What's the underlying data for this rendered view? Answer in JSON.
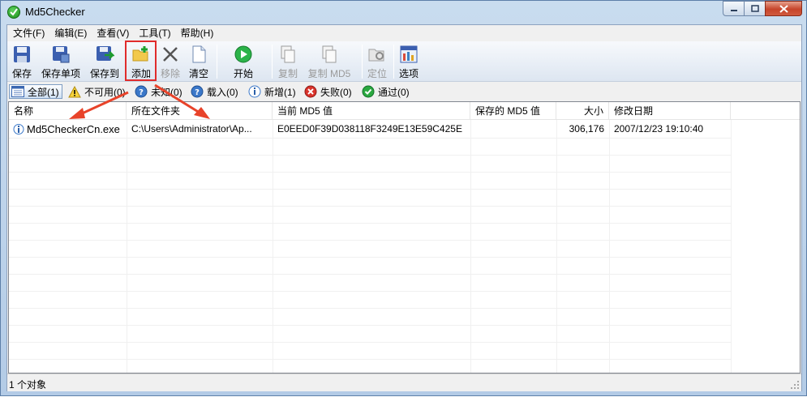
{
  "window": {
    "title": "Md5Checker"
  },
  "menu": [
    "文件(F)",
    "编辑(E)",
    "查看(V)",
    "工具(T)",
    "帮助(H)"
  ],
  "toolbar": {
    "save": "保存",
    "save_item": "保存单项",
    "save_to": "保存到",
    "add": "添加",
    "remove": "移除",
    "clear": "清空",
    "start": "开始",
    "copy": "复制",
    "copy_md5": "复制 MD5",
    "locate": "定位",
    "options": "选项"
  },
  "filters": {
    "all": "全部(1)",
    "unavailable": "不可用(0)",
    "unknown": "未知(0)",
    "loaded": "载入(0)",
    "new": "新增(1)",
    "failed": "失败(0)",
    "passed": "通过(0)"
  },
  "columns": {
    "name": "名称",
    "folder": "所在文件夹",
    "current_md5": "当前 MD5 值",
    "saved_md5": "保存的 MD5 值",
    "size": "大小",
    "modified": "修改日期"
  },
  "rows": [
    {
      "name": "Md5CheckerCn.exe",
      "folder": "C:\\Users\\Administrator\\Ap...",
      "current_md5": "E0EED0F39D038118F3249E13E59C425E",
      "saved_md5": "",
      "size": "306,176",
      "modified": "2007/12/23 19:10:40"
    }
  ],
  "status": {
    "text": "1 个对象"
  },
  "colors": {
    "highlight": "#e02c2c",
    "arrow": "#e8432a"
  }
}
